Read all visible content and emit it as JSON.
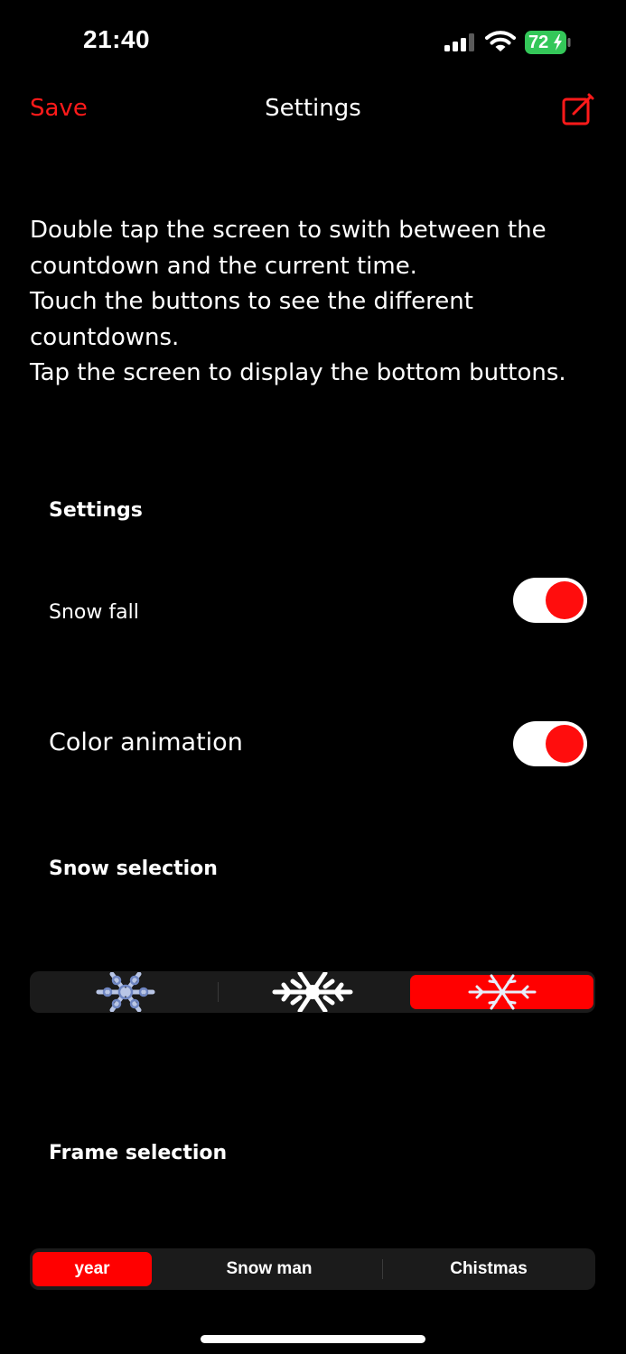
{
  "status_bar": {
    "time": "21:40",
    "battery": "72"
  },
  "nav": {
    "save_label": "Save",
    "title": "Settings",
    "compose_icon": "compose-icon"
  },
  "instructions": [
    "Double tap the screen to swith between the",
    "countdown and the current time.",
    "Touch the buttons to see the different",
    "countdowns.",
    "Tap the screen to display the bottom buttons."
  ],
  "settings": {
    "section_title": "Settings",
    "snow_fall_label": "Snow fall",
    "snow_fall_on": true,
    "color_animation_label": "Color animation",
    "color_animation_on": true
  },
  "snow_selection": {
    "title": "Snow selection",
    "options": [
      "snowflake-blue-icon",
      "snowflake-white-icon",
      "snowflake-light-icon"
    ],
    "selected_index": 2
  },
  "frame_selection": {
    "title": "Frame selection",
    "options": [
      "year",
      "Snow man",
      "Chistmas"
    ],
    "selected_index": 0
  },
  "colors": {
    "accent": "#ff0000",
    "background": "#000000",
    "battery_green": "#34c759"
  }
}
